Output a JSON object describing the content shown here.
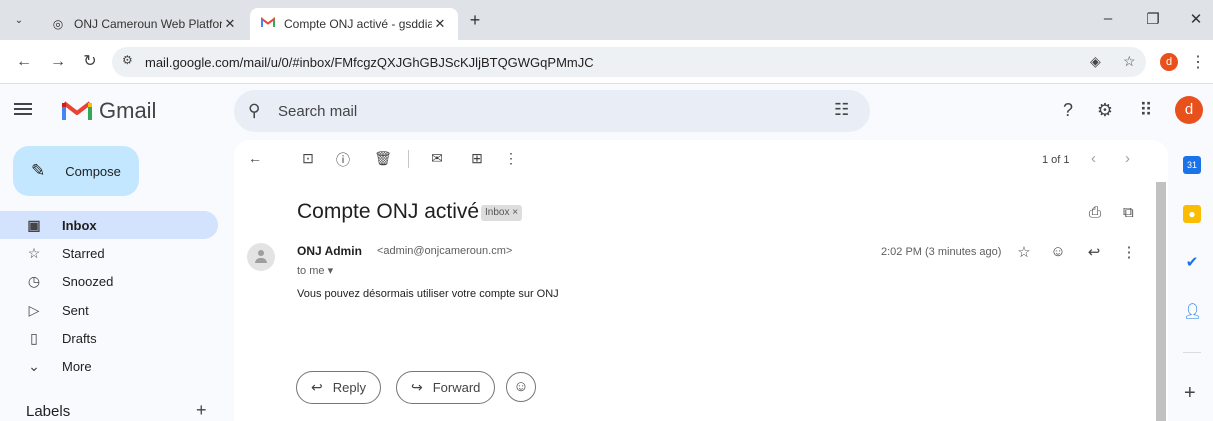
{
  "browser": {
    "tabs": [
      {
        "title": "ONJ Cameroun Web Platform",
        "icon": "globe-icon"
      },
      {
        "title": "Compte ONJ activé - gsddialyj@",
        "icon": "gmail-icon"
      }
    ],
    "url": "mail.google.com/mail/u/0/#inbox/FMfcgzQXJGhGBJScKJljBTQGWGqPMmJC",
    "profile_initial": "d"
  },
  "gmail": {
    "brand": "Gmail",
    "search_placeholder": "Search mail",
    "avatar_initial": "d",
    "compose_label": "Compose",
    "nav": [
      {
        "label": "Inbox",
        "icon": "inbox-icon",
        "active": true
      },
      {
        "label": "Starred",
        "icon": "star-icon",
        "active": false
      },
      {
        "label": "Snoozed",
        "icon": "clock-icon",
        "active": false
      },
      {
        "label": "Sent",
        "icon": "send-icon",
        "active": false
      },
      {
        "label": "Drafts",
        "icon": "draft-icon",
        "active": false
      },
      {
        "label": "More",
        "icon": "chevron-down-icon",
        "active": false
      }
    ],
    "labels_heading": "Labels"
  },
  "message": {
    "pager": "1 of 1",
    "subject": "Compte ONJ activé",
    "label_chip": "Inbox ×",
    "sender_name": "ONJ Admin",
    "sender_email": "<admin@onjcameroun.cm>",
    "recipient": "to me ▾",
    "time": "2:02 PM (3 minutes ago)",
    "body": "Vous pouvez désormais utiliser votre compte sur ONJ",
    "reply_label": "Reply",
    "forward_label": "Forward"
  },
  "colors": {
    "accent": "#c2e7ff",
    "active_nav": "#d3e3fd",
    "avatar": "#e8501c"
  }
}
